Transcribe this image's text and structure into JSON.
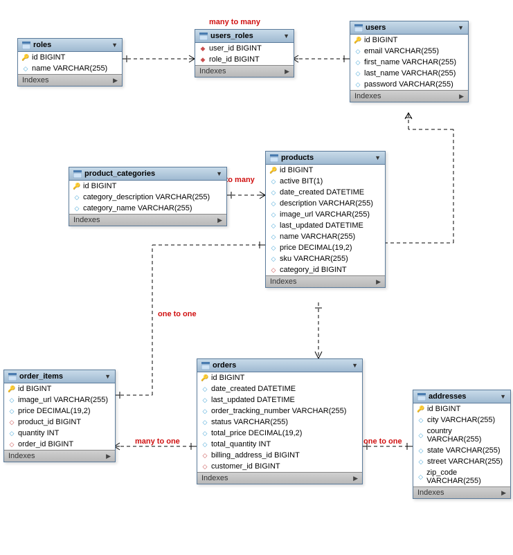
{
  "labels": {
    "indexes": "Indexes",
    "many_to_many": "many to many",
    "one_to_many": "one to many",
    "one_to_one": "one to one",
    "many_to_one": "many to one"
  },
  "entities": {
    "roles": {
      "title": "roles",
      "cols": [
        {
          "icon": "key",
          "text": "id BIGINT"
        },
        {
          "icon": "blue",
          "text": "name VARCHAR(255)"
        }
      ]
    },
    "users_roles": {
      "title": "users_roles",
      "cols": [
        {
          "icon": "red",
          "text": "user_id BIGINT"
        },
        {
          "icon": "red",
          "text": "role_id BIGINT"
        }
      ]
    },
    "users": {
      "title": "users",
      "cols": [
        {
          "icon": "key",
          "text": "id BIGINT"
        },
        {
          "icon": "blue",
          "text": "email VARCHAR(255)"
        },
        {
          "icon": "blue",
          "text": "first_name VARCHAR(255)"
        },
        {
          "icon": "blue",
          "text": "last_name VARCHAR(255)"
        },
        {
          "icon": "blue",
          "text": "password VARCHAR(255)"
        }
      ]
    },
    "product_categories": {
      "title": "product_categories",
      "cols": [
        {
          "icon": "key",
          "text": "id BIGINT"
        },
        {
          "icon": "blue",
          "text": "category_description VARCHAR(255)"
        },
        {
          "icon": "blue",
          "text": "category_name VARCHAR(255)"
        }
      ]
    },
    "products": {
      "title": "products",
      "cols": [
        {
          "icon": "key",
          "text": "id BIGINT"
        },
        {
          "icon": "blue",
          "text": "active BIT(1)"
        },
        {
          "icon": "blue",
          "text": "date_created DATETIME"
        },
        {
          "icon": "blue",
          "text": "description VARCHAR(255)"
        },
        {
          "icon": "blue",
          "text": "image_url VARCHAR(255)"
        },
        {
          "icon": "blue",
          "text": "last_updated DATETIME"
        },
        {
          "icon": "blue",
          "text": "name VARCHAR(255)"
        },
        {
          "icon": "blue",
          "text": "price DECIMAL(19,2)"
        },
        {
          "icon": "blue",
          "text": "sku VARCHAR(255)"
        },
        {
          "icon": "red",
          "text": "category_id BIGINT"
        }
      ]
    },
    "order_items": {
      "title": "order_items",
      "cols": [
        {
          "icon": "key",
          "text": "id BIGINT"
        },
        {
          "icon": "blue",
          "text": "image_url VARCHAR(255)"
        },
        {
          "icon": "blue",
          "text": "price DECIMAL(19,2)"
        },
        {
          "icon": "red",
          "text": "product_id BIGINT"
        },
        {
          "icon": "blue",
          "text": "quantity INT"
        },
        {
          "icon": "red",
          "text": "order_id BIGINT"
        }
      ]
    },
    "orders": {
      "title": "orders",
      "cols": [
        {
          "icon": "key",
          "text": "id BIGINT"
        },
        {
          "icon": "blue",
          "text": "date_created DATETIME"
        },
        {
          "icon": "blue",
          "text": "last_updated DATETIME"
        },
        {
          "icon": "blue",
          "text": "order_tracking_number VARCHAR(255)"
        },
        {
          "icon": "blue",
          "text": "status VARCHAR(255)"
        },
        {
          "icon": "blue",
          "text": "total_price DECIMAL(19,2)"
        },
        {
          "icon": "blue",
          "text": "total_quantity INT"
        },
        {
          "icon": "red",
          "text": "billing_address_id BIGINT"
        },
        {
          "icon": "red",
          "text": "customer_id BIGINT"
        }
      ]
    },
    "addresses": {
      "title": "addresses",
      "cols": [
        {
          "icon": "key",
          "text": "id BIGINT"
        },
        {
          "icon": "blue",
          "text": "city VARCHAR(255)"
        },
        {
          "icon": "blue",
          "text": "country VARCHAR(255)"
        },
        {
          "icon": "blue",
          "text": "state VARCHAR(255)"
        },
        {
          "icon": "blue",
          "text": "street VARCHAR(255)"
        },
        {
          "icon": "blue",
          "text": "zip_code VARCHAR(255)"
        }
      ]
    }
  }
}
